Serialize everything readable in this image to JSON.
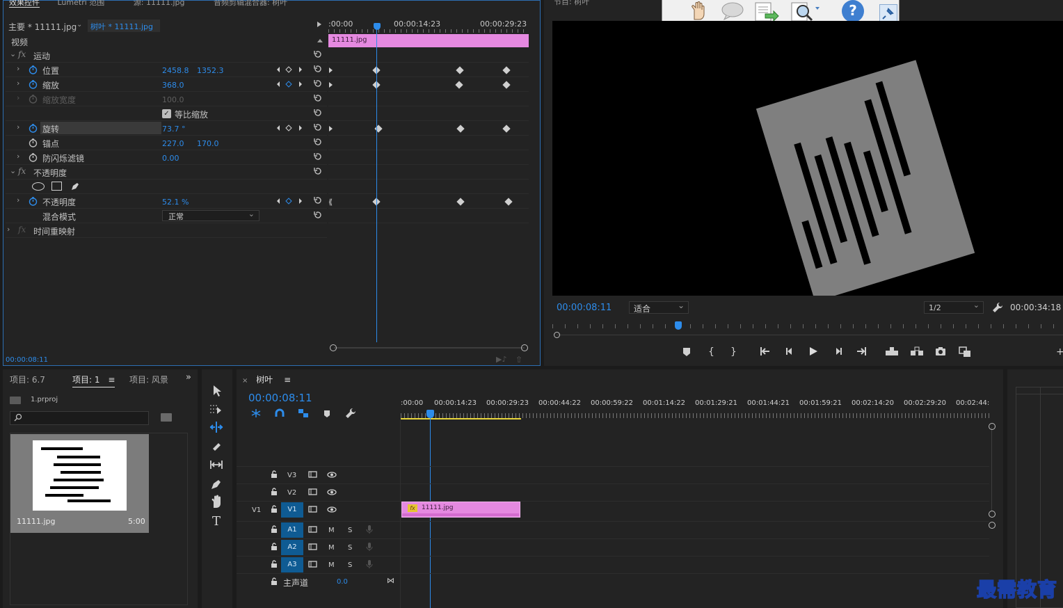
{
  "effect_controls": {
    "tabs": [
      "效果控件",
      "Lumetri 范围",
      "源: 11111.jpg",
      "音频剪辑混合器: 树叶"
    ],
    "master_label": "主要 * 11111.jpg",
    "clip_label": "树叶 * 11111.jpg",
    "section_video": "视频",
    "timecode_start": ":00:00",
    "timecode_mid": "00:00:14:23",
    "timecode_end": "00:00:29:23",
    "clip_name": "11111.jpg",
    "footer_time": "00:00:08:11",
    "rows": {
      "motion": "运动",
      "position": "位置",
      "position_x": "2458.8",
      "position_y": "1352.3",
      "scale": "缩放",
      "scale_val": "368.0",
      "scale_width": "缩放宽度",
      "scale_width_val": "100.0",
      "uniform": "等比缩放",
      "rotation": "旋转",
      "rotation_val": "73.7 °",
      "anchor": "锚点",
      "anchor_x": "227.0",
      "anchor_y": "170.0",
      "flicker": "防闪烁滤镜",
      "flicker_val": "0.00",
      "opacity_group": "不透明度",
      "opacity": "不透明度",
      "opacity_val": "52.1 %",
      "blend": "混合模式",
      "blend_val": "正常",
      "time_remap": "时间重映射"
    }
  },
  "program": {
    "title": "节目: 树叶",
    "timecode": "00:00:08:11",
    "fit": "适合",
    "resolution": "1/2",
    "duration": "00:00:34:18"
  },
  "project": {
    "tabs": [
      "项目: 6.7",
      "项目: 1",
      "项目: 风景"
    ],
    "file": "1.prproj",
    "item_name": "11111.jpg",
    "item_duration": "5:00"
  },
  "timeline": {
    "tab": "树叶",
    "timecode": "00:00:08:11",
    "ruler": [
      ":00:00",
      "00:00:14:23",
      "00:00:29:23",
      "00:00:44:22",
      "00:00:59:22",
      "00:01:14:22",
      "00:01:29:21",
      "00:01:44:21",
      "00:01:59:21",
      "00:02:14:20",
      "00:02:29:20",
      "00:02:44:"
    ],
    "tracks": {
      "v3": "V3",
      "v2": "V2",
      "v1_src": "V1",
      "v1": "V1",
      "a1": "A1",
      "a2": "A2",
      "a3": "A3",
      "m": "M",
      "s": "S"
    },
    "master": "主声道",
    "master_val": "0.0",
    "clip": "11111.jpg"
  },
  "watermark": "最需教育"
}
